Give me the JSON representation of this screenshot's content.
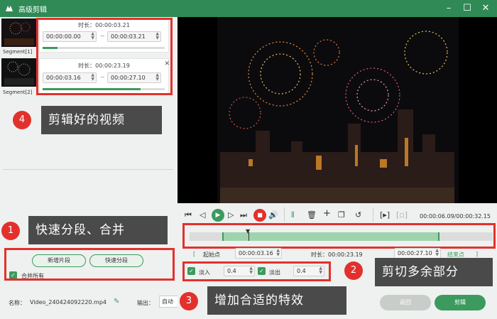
{
  "window": {
    "title": "高级剪辑",
    "controls": [
      "–",
      "☐",
      "✕"
    ]
  },
  "segments": [
    {
      "label": "Segment[1]",
      "duration_label": "时长：00:00:03.21",
      "start": "00:00:00.00",
      "end": "00:00:03.21",
      "sep": "~"
    },
    {
      "label": "Segment[2]",
      "duration_label": "时长：00:00:23.19",
      "start": "00:00:03.16",
      "end": "00:00:27.10",
      "sep": "~"
    }
  ],
  "left": {
    "new_segment": "新增片段",
    "quick_split": "快速分段",
    "merge_all": "合并所有",
    "name_label": "名称：",
    "name_value": "Video_240424092220.mp4",
    "output_label": "输出：",
    "output_value": "自动",
    "callouts": {
      "c4": "剪辑好的视频",
      "c1": "快速分段、合并",
      "c3": "增加合适的特效"
    },
    "badges": {
      "b1": "1",
      "b3": "3",
      "b4": "4"
    }
  },
  "player": {
    "time": "00:00:06.09/00:00:32.15",
    "start_label": "起始点",
    "start_value": "00:00:03.16",
    "duration_label": "时长：00:00:23.19",
    "end_value": "00:00:27.10",
    "end_label": "结束点",
    "fade_in_label": "淡入",
    "fade_in_value": "0.4",
    "fade_out_label": "淡出",
    "fade_out_value": "0.4",
    "callout": "剪切多余部分",
    "badge": "2",
    "back": "返回",
    "clip": "剪辑"
  },
  "colors": {
    "accent": "#2f8a55",
    "highlight": "#e2312c"
  }
}
